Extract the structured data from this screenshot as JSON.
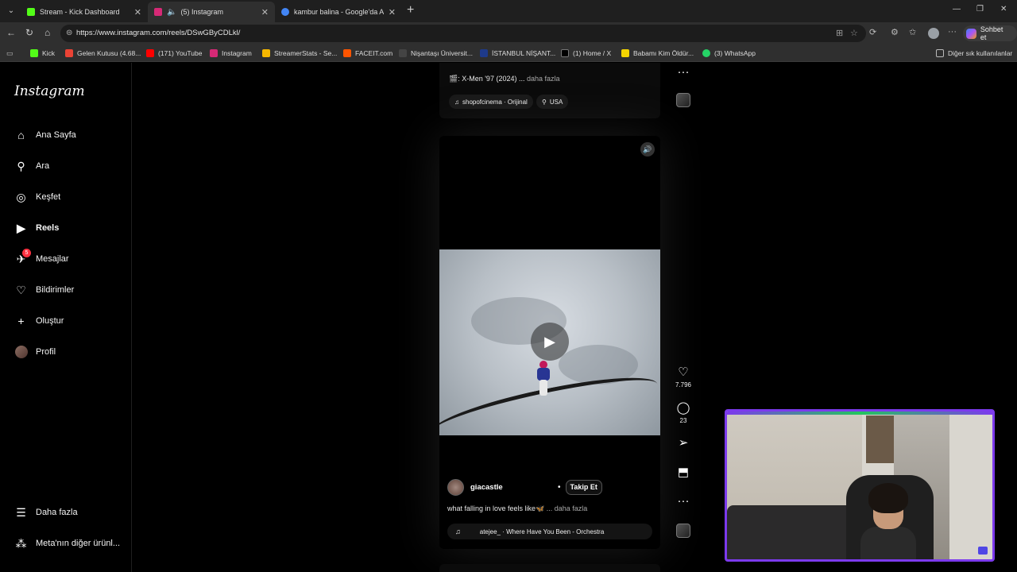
{
  "browser": {
    "tabs": [
      {
        "title": "Stream - Kick Dashboard",
        "favicon_color": "#53fc18",
        "active": false
      },
      {
        "title": "(5) Instagram",
        "favicon_color": "#d62976",
        "active": true
      },
      {
        "title": "kambur balina - Google'da Ara",
        "favicon_color": "#4285f4",
        "active": false
      }
    ],
    "close_glyph": "✕",
    "new_tab_glyph": "+",
    "url": "https://www.instagram.com/reels/DSwGByCDLkl/",
    "copilot_label": "Sohbet et",
    "bookmarks": [
      {
        "label": "Kick",
        "color": "#53fc18"
      },
      {
        "label": "Gelen Kutusu (4.68...",
        "color": "#ea4335"
      },
      {
        "label": "(171) YouTube",
        "color": "#ff0000"
      },
      {
        "label": "Instagram",
        "color": "#d62976"
      },
      {
        "label": "StreamerStats - Se...",
        "color": "#f5b700"
      },
      {
        "label": "FACEIT.com",
        "color": "#ff5500"
      },
      {
        "label": "Nişantaşı Üniversit...",
        "color": "#444444"
      },
      {
        "label": "İSTANBUL NİŞANT...",
        "color": "#1e3a8a"
      },
      {
        "label": "(1) Home / X",
        "color": "#000000"
      },
      {
        "label": "Babamı Kim Öldür...",
        "color": "#f5d400"
      },
      {
        "label": "(3) WhatsApp",
        "color": "#25d366"
      }
    ],
    "other_bookmarks": "Diğer sık kullanılanlar"
  },
  "sidebar": {
    "logo": "Instagram",
    "items": [
      {
        "label": "Ana Sayfa",
        "icon": "home-icon",
        "glyph": "⌂"
      },
      {
        "label": "Ara",
        "icon": "search-icon",
        "glyph": "⚲"
      },
      {
        "label": "Keşfet",
        "icon": "compass-icon",
        "glyph": "◎"
      },
      {
        "label": "Reels",
        "icon": "reels-icon",
        "glyph": "▶"
      },
      {
        "label": "Mesajlar",
        "icon": "messenger-icon",
        "glyph": "✈",
        "badge": "5"
      },
      {
        "label": "Bildirimler",
        "icon": "heart-icon",
        "glyph": "♡"
      },
      {
        "label": "Oluştur",
        "icon": "plus-icon",
        "glyph": "+"
      },
      {
        "label": "Profil",
        "icon": "profile-avatar",
        "glyph": ""
      }
    ],
    "bottom_items": [
      {
        "label": "Daha fazla",
        "icon": "menu-icon",
        "glyph": "☰"
      },
      {
        "label": "Meta'nın diğer ürünl...",
        "icon": "meta-apps-icon",
        "glyph": "⁂"
      }
    ]
  },
  "previous_reel": {
    "caption": "🎬: X-Men '97 (2024) ...",
    "more": "daha fazla",
    "audio": "shopofcinema · Orijinal",
    "location": "USA"
  },
  "reel": {
    "author": "giacastle",
    "follow_label": "Takip Et",
    "caption": "what falling in love feels like🦋",
    "more": "... daha fazla",
    "audio": "atejee_ · Where Have You Been - Orchestra",
    "likes": "7.796",
    "comments": "23"
  },
  "actions": {
    "like_icon": "♡",
    "comment_icon": "◯",
    "share_icon": "➢",
    "save_icon": "⬒",
    "more_icon": "···"
  }
}
